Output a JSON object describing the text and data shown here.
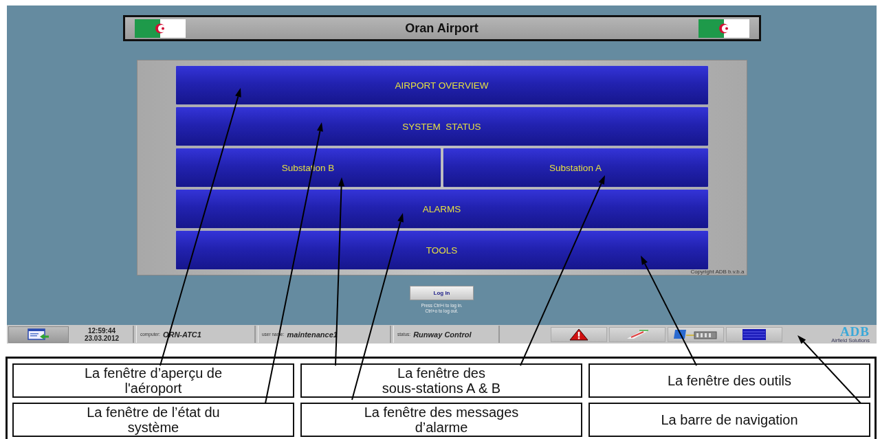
{
  "title_bar": {
    "title": "Oran Airport"
  },
  "menu": {
    "rows": [
      {
        "buttons": [
          "AIRPORT OVERVIEW"
        ]
      },
      {
        "buttons": [
          "SYSTEM  STATUS"
        ]
      },
      {
        "buttons": [
          "Substation B",
          "Substation A"
        ]
      },
      {
        "buttons": [
          "ALARMS"
        ]
      },
      {
        "buttons": [
          "TOOLS"
        ]
      }
    ],
    "copyright": "Copyright ADB b.v.b.a"
  },
  "login": {
    "button": "Log In",
    "hints": [
      "Press Ctrl+i to log in.",
      "Ctrl+o to log out."
    ]
  },
  "taskbar": {
    "time": "12:59:44",
    "date": "23.03.2012",
    "fields": [
      {
        "label": "computer:",
        "value": "ORN-ATC1"
      },
      {
        "label": "user name:",
        "value": "maintenance1"
      },
      {
        "label": "status:",
        "value": "Runway Control"
      }
    ],
    "logo": {
      "name": "ADB",
      "tagline": "Airfield Solutions"
    }
  },
  "legend": [
    [
      "La fenêtre d’aperçu de\nl'aéroport",
      "La fenêtre des\nsous-stations A & B",
      "La fenêtre des outils"
    ],
    [
      "La fenêtre de l’état du\nsystème",
      "La fenêtre des messages\nd’alarme",
      "La barre de navigation"
    ]
  ]
}
